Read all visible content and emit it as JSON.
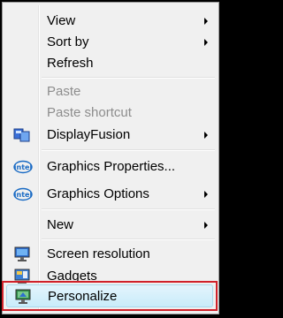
{
  "menu": {
    "items": {
      "view": {
        "label": "View"
      },
      "sort_by": {
        "label": "Sort by"
      },
      "refresh": {
        "label": "Refresh"
      },
      "paste": {
        "label": "Paste"
      },
      "paste_shortcut": {
        "label": "Paste shortcut"
      },
      "displayfusion": {
        "label": "DisplayFusion"
      },
      "graphics_properties": {
        "label": "Graphics Properties..."
      },
      "graphics_options": {
        "label": "Graphics Options"
      },
      "new": {
        "label": "New"
      },
      "screen_resolution": {
        "label": "Screen resolution"
      },
      "gadgets": {
        "label": "Gadgets"
      },
      "personalize": {
        "label": "Personalize"
      }
    }
  },
  "icons": {
    "displayfusion": "displayfusion-icon",
    "graphics_properties": "intel-icon",
    "graphics_options": "intel-icon",
    "screen_resolution": "monitor-icon",
    "gadgets": "gadgets-icon",
    "personalize": "personalize-icon"
  },
  "colors": {
    "highlight_border": "#d0212a",
    "menu_background": "#f0f0f0",
    "disabled_text": "#8d8d8d"
  }
}
